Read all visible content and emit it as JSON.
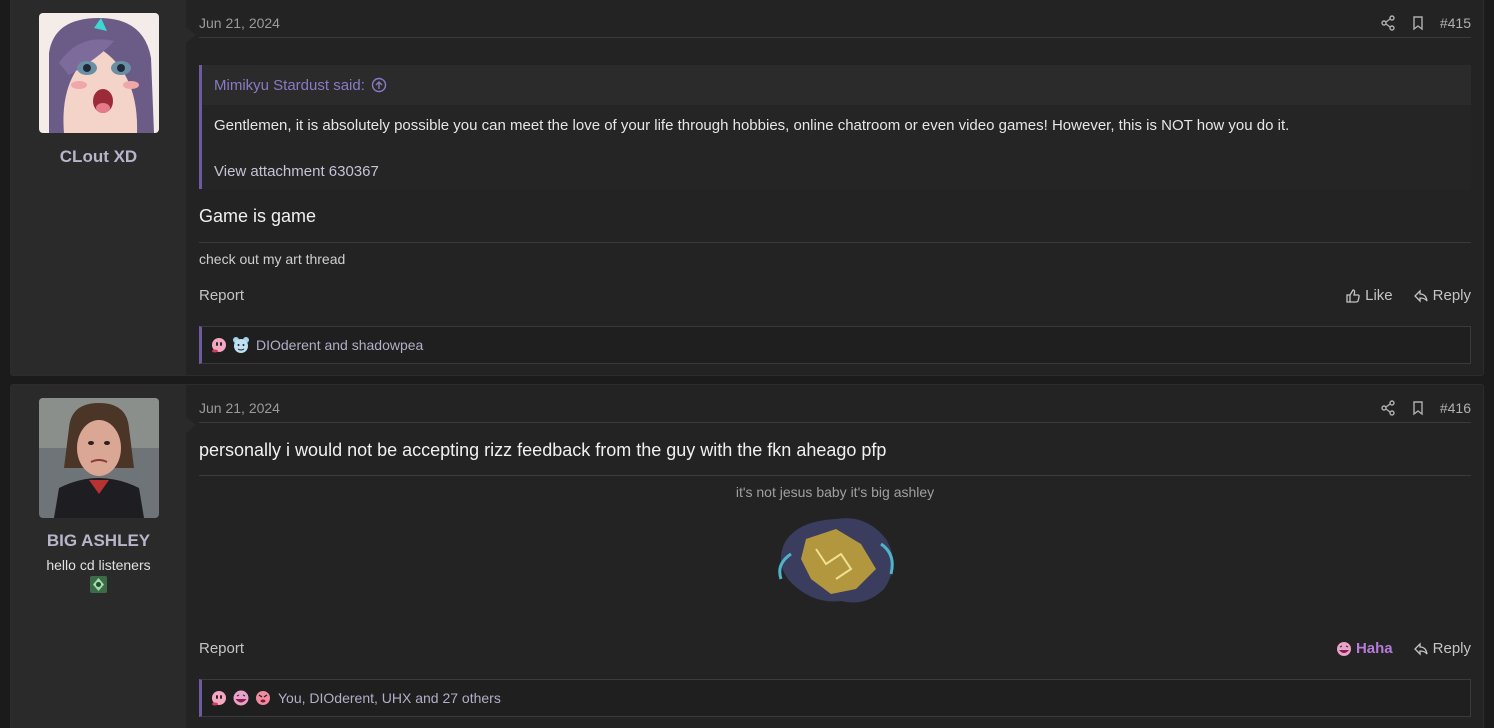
{
  "posts": [
    {
      "username": "CLout XD",
      "date": "Jun 21, 2024",
      "number": "#415",
      "quote": {
        "author_line": "Mimikyu Stardust said:",
        "body": "Gentlemen, it is absolutely possible you can meet the love of your life through hobbies, online chatroom or even video games! However, this is NOT how you do it.",
        "attachment": "View attachment 630367"
      },
      "message": "Game is game",
      "signature": "check out my art thread",
      "report_label": "Report",
      "reaction_button": "Like",
      "reply_label": "Reply",
      "reactions_text": "DIOderent and shadowpea"
    },
    {
      "username": "BIG ASHLEY",
      "user_title": "hello cd listeners",
      "date": "Jun 21, 2024",
      "number": "#416",
      "message": "personally i would not be accepting rizz feedback from the guy with the fkn aheago pfp",
      "signature": "it's not jesus baby it's big ashley",
      "report_label": "Report",
      "reaction_button": "Haha",
      "reply_label": "Reply",
      "reactions_text": "You, DIOderent, UHX and 27 others"
    }
  ],
  "colors": {
    "accent": "#6e5a9e",
    "username": "#b9b4c9",
    "haha": "#b47bd9"
  }
}
